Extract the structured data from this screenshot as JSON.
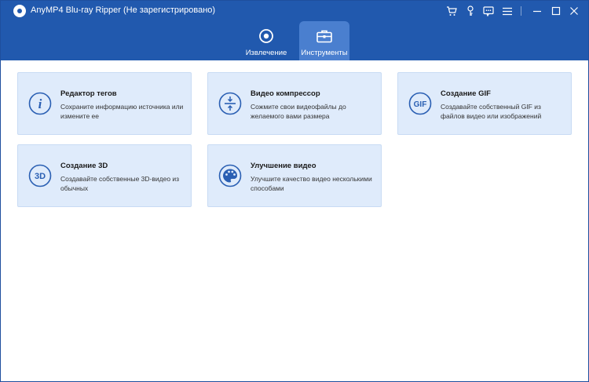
{
  "window": {
    "title": "AnyMP4 Blu-ray Ripper  (Не зарегистрировано)"
  },
  "titlebar_icons": [
    "cart-icon",
    "key-icon",
    "feedback-icon",
    "menu-icon",
    "minimize-icon",
    "maximize-icon",
    "close-icon"
  ],
  "tabs": [
    {
      "label": "Извлечение",
      "icon": "disc-icon",
      "active": false
    },
    {
      "label": "Инструменты",
      "icon": "toolbox-icon",
      "active": true
    }
  ],
  "tools": [
    {
      "title": "Редактор тегов",
      "description": "Сохраните информацию источника или измените ее",
      "icon": "info-icon"
    },
    {
      "title": "Видео компрессор",
      "description": "Сожмите свои видеофайлы до желаемого вами размера",
      "icon": "compress-icon"
    },
    {
      "title": "Создание GIF",
      "description": "Создавайте собственный GIF из файлов видео или изображений",
      "icon": "gif-icon",
      "icon_text": "GIF"
    },
    {
      "title": "Создание 3D",
      "description": "Создавайте собственные 3D-видео из обычных",
      "icon": "3d-icon",
      "icon_text": "3D"
    },
    {
      "title": "Улучшение видео",
      "description": "Улучшите качество видео несколькими способами",
      "icon": "palette-icon"
    }
  ],
  "colors": {
    "header": "#2159ae",
    "active_tab": "#4a7fcf",
    "card_bg": "#dfebfb",
    "icon": "#2a5fb3"
  }
}
